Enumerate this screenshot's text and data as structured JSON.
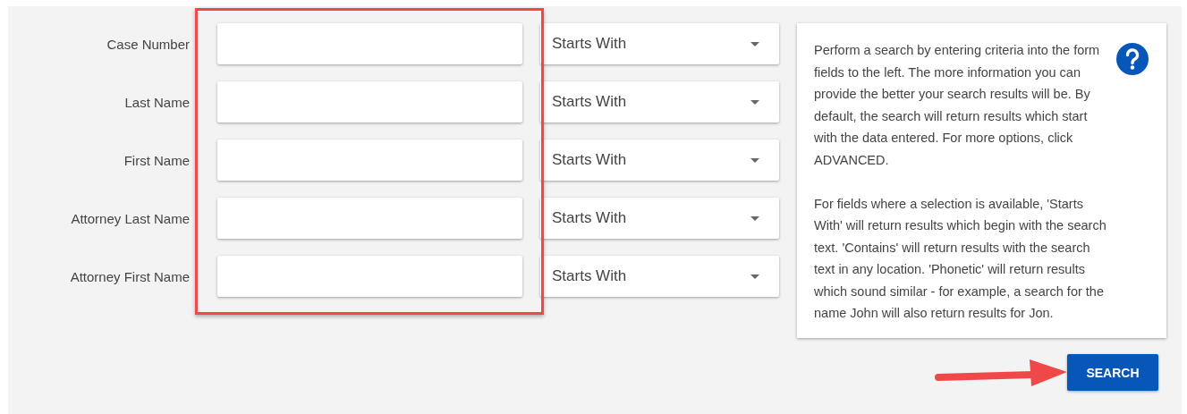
{
  "search_form": {
    "fields": [
      {
        "label": "Case Number",
        "match_mode": "Starts With"
      },
      {
        "label": "Last Name",
        "match_mode": "Starts With"
      },
      {
        "label": "First Name",
        "match_mode": "Starts With"
      },
      {
        "label": "Attorney Last Name",
        "match_mode": "Starts With"
      },
      {
        "label": "Attorney First Name",
        "match_mode": "Starts With"
      }
    ]
  },
  "help_card": {
    "paragraphs": [
      "Perform a search by entering criteria into the form fields to the left. The more information you can provide the better your search results will be. By default, the search will return results which start with the data entered. For more options, click ADVANCED.",
      "For fields where a selection is available, 'Starts With' will return results which begin with the search text. 'Contains' will return results with the search text in any location. 'Phonetic' will return results which sound similar - for example, a search for the name John will also return results for Jon."
    ]
  },
  "search_button": {
    "label": "SEARCH"
  },
  "annotations": {
    "highlight_box": true,
    "arrow": true
  }
}
